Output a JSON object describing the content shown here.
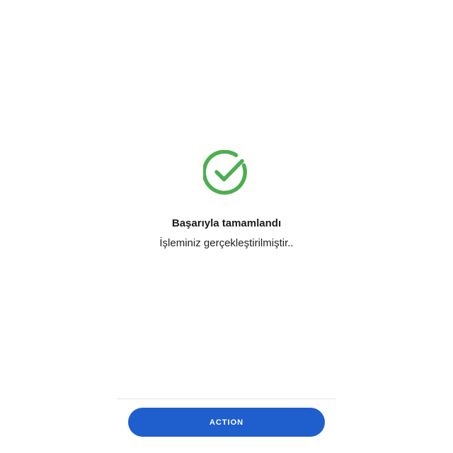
{
  "result": {
    "icon": "check-circle-icon",
    "title": "Başarıyla tamamlandı",
    "message": "İşleminiz gerçekleştirilmiştir.."
  },
  "footer": {
    "action_label": "ACTION"
  },
  "colors": {
    "success": "#4caf50",
    "primary": "#1f5fcd",
    "divider": "#e4e4e4",
    "text": "#1c1c1c",
    "background": "#ffffff"
  }
}
